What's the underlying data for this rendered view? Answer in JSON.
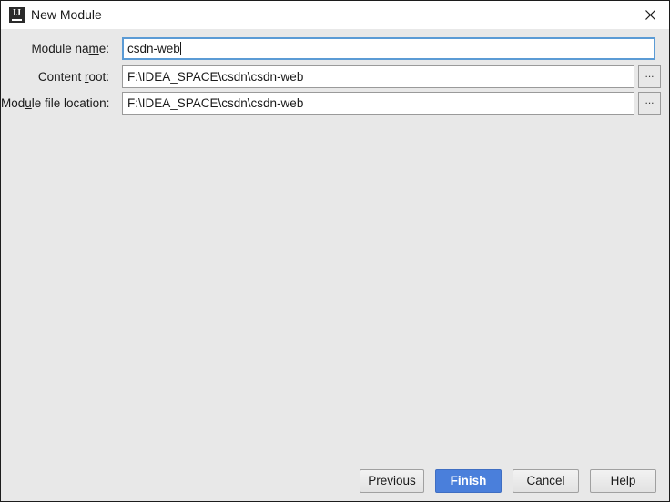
{
  "window": {
    "title": "New Module",
    "app_icon": "intellij-idea-icon",
    "icon_letters": "IJ",
    "close_icon": "close-icon"
  },
  "form": {
    "fields": [
      {
        "id": "module-name",
        "label_before": "Module na",
        "label_mnemonic": "m",
        "label_after": "e:",
        "label_full": "Module name:",
        "value": "csdn-web",
        "focused": true,
        "has_browse": false
      },
      {
        "id": "content-root",
        "label_before": "Content ",
        "label_mnemonic": "r",
        "label_after": "oot:",
        "label_full": "Content root:",
        "value": "F:\\IDEA_SPACE\\csdn\\csdn-web",
        "focused": false,
        "has_browse": true,
        "browse_label": "..."
      },
      {
        "id": "module-file-location",
        "label_before": "Mod",
        "label_mnemonic": "u",
        "label_after": "le file location:",
        "label_full": "Module file location:",
        "value": "F:\\IDEA_SPACE\\csdn\\csdn-web",
        "focused": false,
        "has_browse": true,
        "browse_label": "..."
      }
    ]
  },
  "buttons": {
    "previous": "Previous",
    "finish": "Finish",
    "cancel": "Cancel",
    "help": "Help"
  },
  "colors": {
    "dialog_background": "#e8e8e8",
    "titlebar_background": "#ffffff",
    "default_button": "#4a7fdb",
    "focus_border": "#5b9bd5",
    "field_border": "#9a9a9a",
    "text": "#1a1a1a"
  }
}
